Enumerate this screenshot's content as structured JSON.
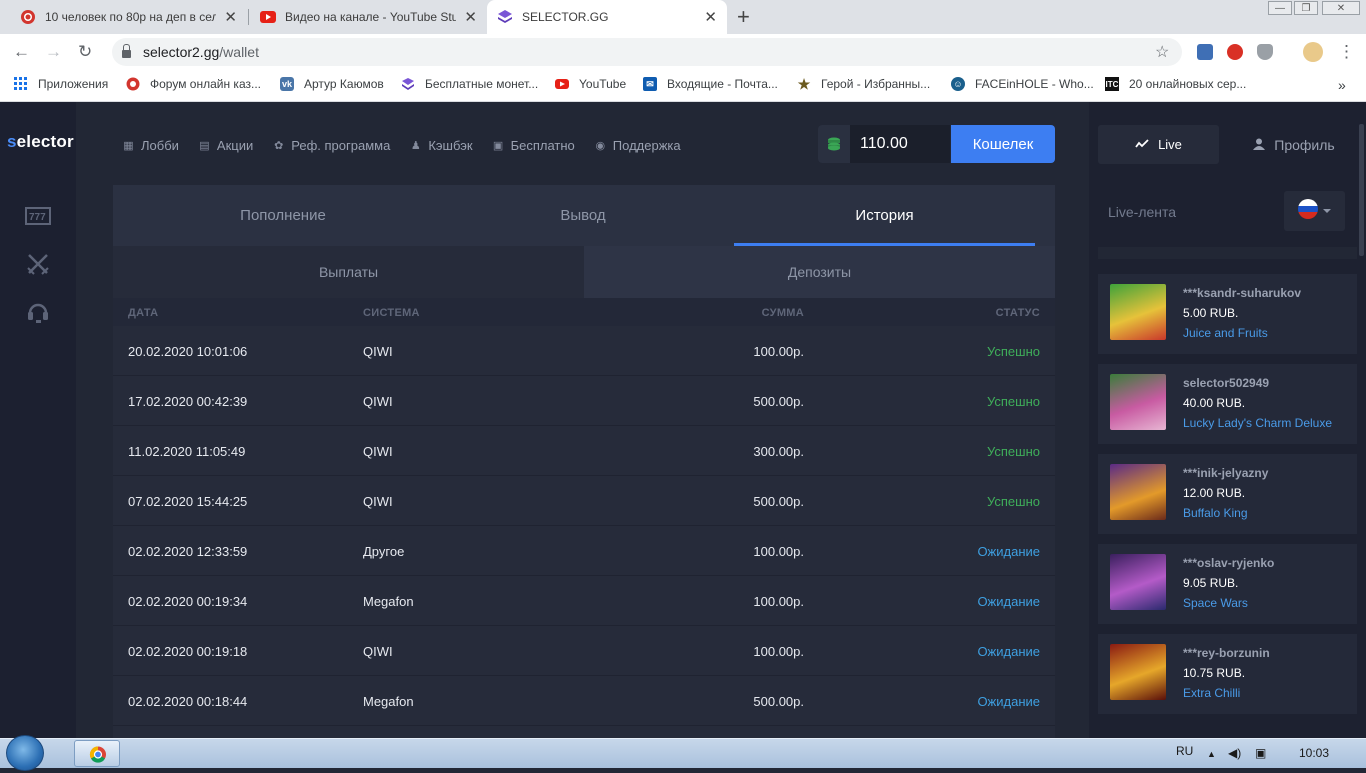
{
  "browser": {
    "tabs": [
      {
        "title": "10 человек по 80р на деп в селе",
        "favicon": "poker-chip-icon",
        "active": false
      },
      {
        "title": "Видео на канале - YouTube Studi",
        "favicon": "youtube-icon",
        "active": false
      },
      {
        "title": "SELECTOR.GG",
        "favicon": "selector-layers-icon",
        "active": true
      }
    ],
    "url_host": "selector2.gg",
    "url_path": "/wallet",
    "bookmarks": [
      {
        "label": "Приложения",
        "icon": "apps-grid-icon"
      },
      {
        "label": "Форум онлайн каз...",
        "icon": "poker-chip-icon"
      },
      {
        "label": "Артур Каюмов",
        "icon": "vk-icon"
      },
      {
        "label": "Бесплатные монет...",
        "icon": "selector-layers-icon"
      },
      {
        "label": "YouTube",
        "icon": "youtube-icon"
      },
      {
        "label": "Входящие - Почта...",
        "icon": "outlook-icon"
      },
      {
        "label": "Герой - Избранны...",
        "icon": "star-icon"
      },
      {
        "label": "FACEinHOLE - Who...",
        "icon": "face-icon"
      },
      {
        "label": "20 онлайновых сер...",
        "icon": "itc-icon"
      }
    ],
    "bookmarks_overflow": "»"
  },
  "site": {
    "logo_prefix": "s",
    "logo_rest": "elector",
    "nav": [
      {
        "label": "Лобби",
        "icon": "lobby-icon"
      },
      {
        "label": "Акции",
        "icon": "promo-icon"
      },
      {
        "label": "Реф. программа",
        "icon": "referral-icon"
      },
      {
        "label": "Кэшбэк",
        "icon": "cashback-icon"
      },
      {
        "label": "Бесплатно",
        "icon": "gift-icon"
      },
      {
        "label": "Поддержка",
        "icon": "support-icon"
      }
    ],
    "balance": "110.00",
    "wallet_button": "Кошелек",
    "main_tabs": [
      "Пополнение",
      "Вывод",
      "История"
    ],
    "active_main_tab": "История",
    "sub_tabs": [
      "Выплаты",
      "Депозиты"
    ],
    "active_sub_tab": "Депозиты",
    "columns": {
      "date": "ДАТА",
      "system": "СИСТЕМА",
      "amount": "СУММА",
      "status": "СТАТУС"
    },
    "rows": [
      {
        "date": "20.02.2020 10:01:06",
        "system": "QIWI",
        "amount": "100.00р.",
        "status": "Успешно",
        "kind": "ok"
      },
      {
        "date": "17.02.2020 00:42:39",
        "system": "QIWI",
        "amount": "500.00р.",
        "status": "Успешно",
        "kind": "ok"
      },
      {
        "date": "11.02.2020 11:05:49",
        "system": "QIWI",
        "amount": "300.00р.",
        "status": "Успешно",
        "kind": "ok"
      },
      {
        "date": "07.02.2020 15:44:25",
        "system": "QIWI",
        "amount": "500.00р.",
        "status": "Успешно",
        "kind": "ok"
      },
      {
        "date": "02.02.2020 12:33:59",
        "system": "Другое",
        "amount": "100.00р.",
        "status": "Ожидание",
        "kind": "wait"
      },
      {
        "date": "02.02.2020 00:19:34",
        "system": "Megafon",
        "amount": "100.00р.",
        "status": "Ожидание",
        "kind": "wait"
      },
      {
        "date": "02.02.2020 00:19:18",
        "system": "QIWI",
        "amount": "100.00р.",
        "status": "Ожидание",
        "kind": "wait"
      },
      {
        "date": "02.02.2020 00:18:44",
        "system": "Megafon",
        "amount": "500.00р.",
        "status": "Ожидание",
        "kind": "wait"
      }
    ],
    "status_colors": {
      "ok": "#3fae5a",
      "wait": "#3e9fe0"
    },
    "accent": "#3d7ef2",
    "sidebar": {
      "live_tab": "Live",
      "profile_tab": "Профиль",
      "feed_title": "Live-лента",
      "language_flag": "russia-flag-icon",
      "feed": [
        {
          "user": "***ksandr-suharukov",
          "amount": "5.00 RUB.",
          "game": "Juice and Fruits",
          "thumb": "juice-and-fruits-thumb"
        },
        {
          "user": "selector502949",
          "amount": "40.00 RUB.",
          "game": "Lucky Lady's Charm Deluxe",
          "thumb": "lucky-ladys-charm-thumb"
        },
        {
          "user": "***inik-jelyazny",
          "amount": "12.00 RUB.",
          "game": "Buffalo King",
          "thumb": "buffalo-king-thumb"
        },
        {
          "user": "***oslav-ryjenko",
          "amount": "9.05 RUB.",
          "game": "Space Wars",
          "thumb": "space-wars-thumb"
        },
        {
          "user": "***rey-borzunin",
          "amount": "10.75 RUB.",
          "game": "Extra Chilli",
          "thumb": "extra-chilli-thumb"
        }
      ]
    }
  },
  "taskbar": {
    "lang": "RU",
    "time": "10:03"
  }
}
